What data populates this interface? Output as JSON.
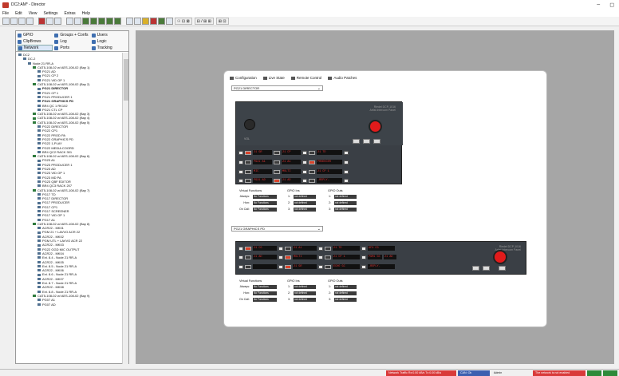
{
  "window": {
    "title": "DC2:AM* - Director",
    "controls": [
      "–",
      "◻"
    ]
  },
  "menu": [
    "File",
    "Edit",
    "View",
    "Settings",
    "Extras",
    "Help"
  ],
  "toolbar": {
    "buttons": [
      "new",
      "open",
      "save",
      "print",
      "cut",
      "copy",
      "paste",
      "sep",
      "connect",
      "disconnect",
      "grid-green-1",
      "grid-green-2",
      "grid-green-3",
      "grid-green-4",
      "grid-green-5",
      "sep",
      "tool-1",
      "tool-2",
      "tool-3",
      "tool-4",
      "tool-5",
      "tool-6"
    ],
    "text_groups": [
      "☉ ⊡ ⊠",
      "⊟ / ⊞ ⊞",
      "⊞ ⊡"
    ]
  },
  "nav_tabs": [
    {
      "label": "GPIO",
      "active": false
    },
    {
      "label": "Groups + Confs",
      "active": false
    },
    {
      "label": "Users",
      "active": false
    },
    {
      "label": "ClipBrows",
      "active": false
    },
    {
      "label": "Log",
      "active": false
    },
    {
      "label": "Logic",
      "active": false
    },
    {
      "label": "Tracking",
      "active": false
    },
    {
      "label": "Network",
      "active": true
    },
    {
      "label": "Ports",
      "active": false
    },
    {
      "label": "ScrollList",
      "active": false
    }
  ],
  "tree": [
    {
      "t": "DC2",
      "d": 0,
      "k": "net"
    },
    {
      "t": "DC-2",
      "d": 1,
      "k": "net"
    },
    {
      "t": "Node 21 RR-A",
      "d": 2,
      "k": "net"
    },
    {
      "t": "CAT5-108-02 w/ AES-108-02 (Bay 1)",
      "d": 3,
      "k": "card"
    },
    {
      "t": "PG21 AD",
      "d": 4,
      "k": "dev"
    },
    {
      "t": "PG21 CP 2",
      "d": 4,
      "k": "dev"
    },
    {
      "t": "PG21 VID OP 1",
      "d": 4,
      "k": "dev"
    },
    {
      "t": "CAT5-108-02 w/ AES-108-02 (Bay 2)",
      "d": 3,
      "k": "card"
    },
    {
      "t": "PG21 DIRECTOR",
      "d": 4,
      "k": "dev",
      "bold": true
    },
    {
      "t": "PG21 CP 1",
      "d": 4,
      "k": "dev"
    },
    {
      "t": "PG21 PRODUCER 1",
      "d": 4,
      "k": "dev"
    },
    {
      "t": "PG21 GRAPHICS PD",
      "d": 4,
      "k": "dev",
      "bold": true
    },
    {
      "t": "BR4 QC 1 RK102",
      "d": 4,
      "k": "dev"
    },
    {
      "t": "PG21 CTL CP",
      "d": 4,
      "k": "dev"
    },
    {
      "t": "CAT5-108-02 w/ AES-108-02 (Bay 3)",
      "d": 3,
      "k": "card"
    },
    {
      "t": "CAT5-108-02 w/ AES-108-02 (Bay 4)",
      "d": 3,
      "k": "card"
    },
    {
      "t": "CAT5-108-02 w/ AES-108-02 (Bay 5)",
      "d": 3,
      "k": "card"
    },
    {
      "t": "PG22 DIRECTOR",
      "d": 4,
      "k": "dev"
    },
    {
      "t": "PG22 CP1",
      "d": 4,
      "k": "dev"
    },
    {
      "t": "PG22 PROD PA",
      "d": 4,
      "k": "dev"
    },
    {
      "t": "PG22 GRAPHICS PD",
      "d": 4,
      "k": "dev"
    },
    {
      "t": "PG22 1-PLAY",
      "d": 4,
      "k": "dev"
    },
    {
      "t": "PG22 MEDIA COORD",
      "d": 4,
      "k": "dev"
    },
    {
      "t": "BR4 QC2 RACK 301",
      "d": 4,
      "k": "dev"
    },
    {
      "t": "CAT5-108-02 w/ AES-108-02 (Bay 6)",
      "d": 3,
      "k": "card"
    },
    {
      "t": "PG23 A1",
      "d": 4,
      "k": "dev"
    },
    {
      "t": "PG23 PRODUCER 1",
      "d": 4,
      "k": "dev"
    },
    {
      "t": "PG23 AD",
      "d": 4,
      "k": "dev"
    },
    {
      "t": "PG23 VID OP 1",
      "d": 4,
      "k": "dev"
    },
    {
      "t": "PG23 MD PA",
      "d": 4,
      "k": "dev"
    },
    {
      "t": "PG23 QBF EDITOR",
      "d": 4,
      "k": "dev"
    },
    {
      "t": "BR4 QC3 RACK 207",
      "d": 4,
      "k": "dev"
    },
    {
      "t": "CAT5-108-02 w/ AES-108-02 (Bay 7)",
      "d": 3,
      "k": "card"
    },
    {
      "t": "PG17 TD",
      "d": 4,
      "k": "dev"
    },
    {
      "t": "PG17 DIRECTOR",
      "d": 4,
      "k": "dev"
    },
    {
      "t": "PG17 PRODUCER",
      "d": 4,
      "k": "dev"
    },
    {
      "t": "PG17 CP1",
      "d": 4,
      "k": "dev"
    },
    {
      "t": "PG17 SCREENER",
      "d": 4,
      "k": "dev"
    },
    {
      "t": "PG17 VID OP 1",
      "d": 4,
      "k": "dev"
    },
    {
      "t": "PG17 A1",
      "d": 4,
      "k": "dev"
    },
    {
      "t": "CAT5-108-02 w/ AES-108-02 (Bay 8)",
      "d": 3,
      "k": "card"
    },
    {
      "t": "ACR22 - MK01",
      "d": 4,
      "k": "dev"
    },
    {
      "t": "PGM 21 + LAVVO ACR 22",
      "d": 4,
      "k": "dev"
    },
    {
      "t": "ACR22 - MK02",
      "d": 4,
      "k": "dev"
    },
    {
      "t": "PGM UTL + LAVVO ACR 22",
      "d": 4,
      "k": "dev"
    },
    {
      "t": "ACR22 - MK03",
      "d": 4,
      "k": "dev"
    },
    {
      "t": "PG22 GGD MIC OUTPUT",
      "d": 4,
      "k": "dev"
    },
    {
      "t": "ACR22 - MK04",
      "d": 4,
      "k": "dev"
    },
    {
      "t": "Ext. 8.4 - Node 21 RR-A",
      "d": 4,
      "k": "dev"
    },
    {
      "t": "ACR22 - MK05",
      "d": 4,
      "k": "dev"
    },
    {
      "t": "Ext. 8.5 - Node 21 RR-A",
      "d": 4,
      "k": "dev"
    },
    {
      "t": "ACR22 - MK06",
      "d": 4,
      "k": "dev"
    },
    {
      "t": "Ext. 8.6 - Node 21 RR-A",
      "d": 4,
      "k": "dev"
    },
    {
      "t": "ACR22 - MK07",
      "d": 4,
      "k": "dev"
    },
    {
      "t": "Ext. 8.7 - Node 21 RR-A",
      "d": 4,
      "k": "dev"
    },
    {
      "t": "ACR22 - MK08",
      "d": 4,
      "k": "dev"
    },
    {
      "t": "Ext. 8.8 - Node 21 RR-A",
      "d": 4,
      "k": "dev"
    },
    {
      "t": "CAT5-108-02 w/ AES-108-02 (Bay 9)",
      "d": 3,
      "k": "card"
    },
    {
      "t": "PG07 A1",
      "d": 4,
      "k": "dev"
    },
    {
      "t": "PG07 AD",
      "d": 4,
      "k": "dev"
    }
  ],
  "dialog": {
    "tabs": [
      "Configuration",
      "Live State",
      "Remote Control",
      "Audio Patches"
    ],
    "panel1": {
      "device": "PG21 DIRECTOR",
      "brand": "Riedel DCP-1016",
      "brand_sub": "Artist Intercom Panel",
      "knob_label": "VOL",
      "left_displays": [
        "21 GR",
        "PG21 A1",
        "MIC",
        "PG21 AD"
      ],
      "mid_displays": [
        "21 CP",
        "21 A1",
        "MULTI",
        "21 AD"
      ],
      "right_displays": [
        "21 TD",
        "PRODUCER",
        "21 CP 1",
        "-REPLY-"
      ],
      "virtual_functions_label": "Virtual Functions",
      "gpio_ins_label": "GPIO Ins",
      "gpio_outs_label": "GPIO Outs",
      "rows": [
        {
          "label": "Always:",
          "func": "No Functions",
          "gin": "not defined",
          "gout": "not defined"
        },
        {
          "label": "Hon:",
          "func": "No Functions",
          "gin": "not defined",
          "gout": "not defined"
        },
        {
          "label": "On Call:",
          "func": "No Functions",
          "gin": "not defined",
          "gout": "not defined"
        }
      ]
    },
    "panel2": {
      "device": "PG21 GRAPHICS PD",
      "brand": "Riedel DCP-1016",
      "brand_sub": "Artist Intercom Panel",
      "displays_row1": [
        "21 CG",
        "21 A1",
        "21 TD",
        "GFX CG"
      ],
      "displays_row2": [
        "21 AD",
        "MULTI",
        "21 CP 1",
        "PGM1 GC",
        "21 AD"
      ],
      "displays_row3": [
        "21 GR",
        "ECHO GC",
        "-REPLY-"
      ],
      "virtual_functions_label": "Virtual Functions",
      "gpio_ins_label": "GPIO Ins",
      "gpio_outs_label": "GPIO Outs",
      "rows": [
        {
          "label": "Always:",
          "func": "No Functions",
          "gin": "not defined",
          "gout": "not defined"
        },
        {
          "label": "Hon:",
          "func": "No Functions",
          "gin": "not defined",
          "gout": "not defined"
        },
        {
          "label": "On Call:",
          "func": "No Functions",
          "gin": "not defined",
          "gout": "not defined"
        }
      ]
    }
  },
  "statusbar": {
    "segments": [
      {
        "text": "",
        "color": "#f0f0f0"
      },
      {
        "text": "Network Traffic Rx:0.00 kB/s Tx:0.00 kB/s",
        "color": "#d93a3a"
      },
      {
        "text": "CAN: Ok",
        "color": "#3c5fb0"
      },
      {
        "text": "Admin",
        "color": "#f0f0f0"
      },
      {
        "text": "The network is not enabled",
        "color": "#d93a3a"
      },
      {
        "text": "",
        "color": "#2e8b3a"
      },
      {
        "text": "",
        "color": "#2e8b3a"
      }
    ]
  },
  "colors": {
    "workspace": "#a6a6a6",
    "knob": "#e21b1b",
    "panel": "#3a3f45",
    "display_text": "#dd3333"
  }
}
